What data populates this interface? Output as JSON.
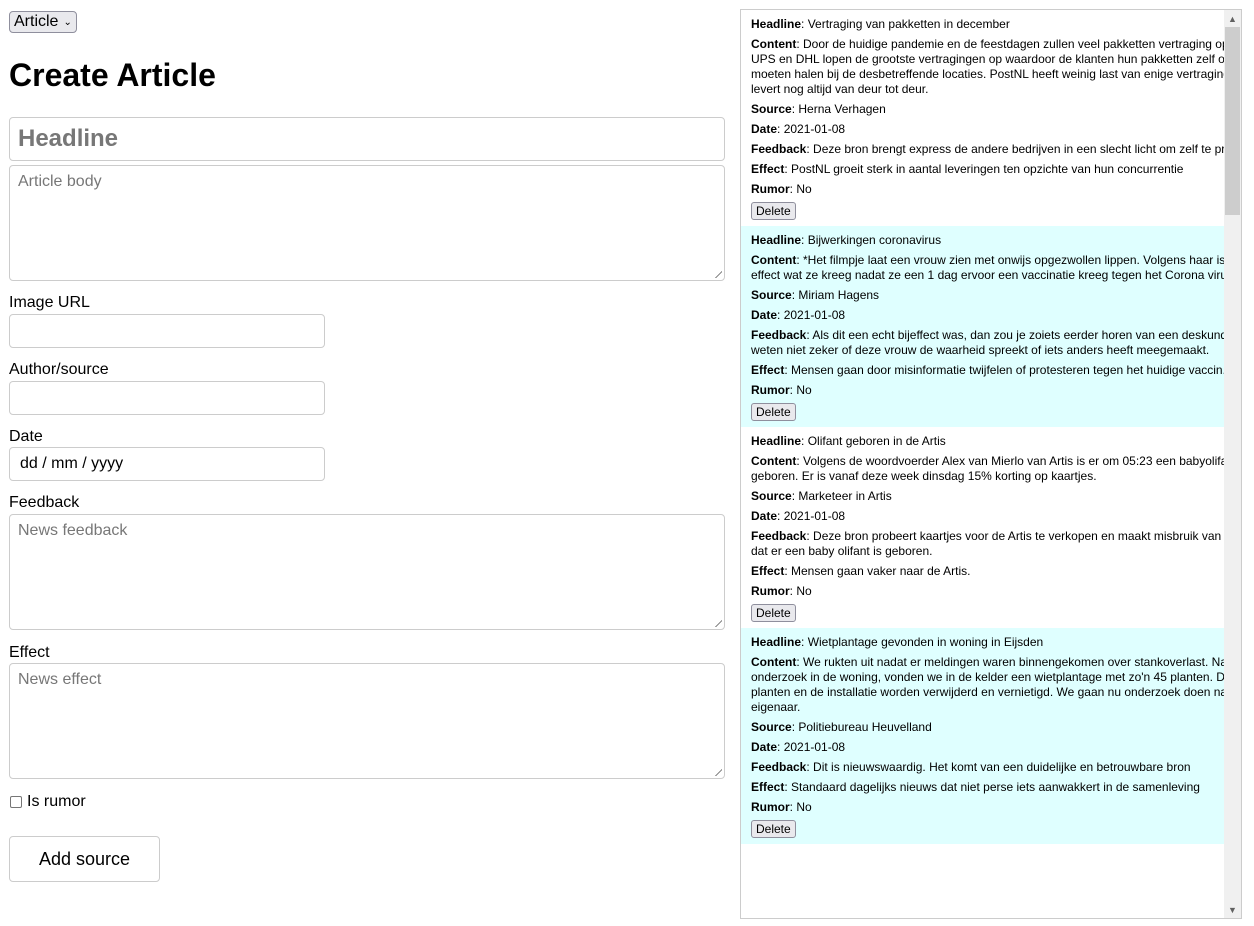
{
  "type_select": {
    "value": "Article"
  },
  "form": {
    "title": "Create Article",
    "headline_placeholder": "Headline",
    "body_placeholder": "Article body",
    "image_url_label": "Image URL",
    "author_label": "Author/source",
    "date_label": "Date",
    "date_placeholder": "dd / mm / yyyy",
    "feedback_label": "Feedback",
    "feedback_placeholder": "News feedback",
    "effect_label": "Effect",
    "effect_placeholder": "News effect",
    "rumor_label": "Is rumor",
    "rumor_checked": false,
    "submit_label": "Add source"
  },
  "field_labels": {
    "headline": "Headline",
    "content": "Content",
    "source": "Source",
    "date": "Date",
    "feedback": "Feedback",
    "effect": "Effect",
    "rumor": "Rumor",
    "delete": "Delete"
  },
  "articles": [
    {
      "headline": "Vertraging van pakketten in december",
      "content": "Door de huidige pandemie en de feestdagen zullen veel pakketten vertraging oplopen. UPS en DHL lopen de grootste vertragingen op waardoor de klanten hun pakketten zelf op moeten halen bij de desbetreffende locaties. PostNL heeft weinig last van enige vertraging en levert nog altijd van deur tot deur.",
      "source": "Herna Verhagen",
      "date": "2021-01-08",
      "feedback": "Deze bron brengt express de andere bedrijven in een slecht licht om zelf te profiteren.",
      "effect": "PostNL groeit sterk in aantal leveringen ten opzichte van hun concurrentie",
      "rumor": "No"
    },
    {
      "headline": "Bijwerkingen coronavirus",
      "content": "*Het filmpje laat een vrouw zien met onwijs opgezwollen lippen. Volgens haar is dit het effect wat ze kreeg nadat ze een 1 dag ervoor een vaccinatie kreeg tegen het Corona virus.",
      "source": "Miriam Hagens",
      "date": "2021-01-08",
      "feedback": "Als dit een echt bijeffect was, dan zou je zoiets eerder horen van een deskundige. We weten niet zeker of deze vrouw de waarheid spreekt of iets anders heeft meegemaakt.",
      "effect": "Mensen gaan door misinformatie twijfelen of protesteren tegen het huidige vaccin.",
      "rumor": "No"
    },
    {
      "headline": "Olifant geboren in de Artis",
      "content": "Volgens de woordvoerder Alex van Mierlo van Artis is er om 05:23 een babyolifant geboren. Er is vanaf deze week dinsdag 15% korting op kaartjes.",
      "source": "Marketeer in Artis",
      "date": "2021-01-08",
      "feedback": "Deze bron probeert kaartjes voor de Artis te verkopen en maakt misbruik van het feit dat er een baby olifant is geboren.",
      "effect": "Mensen gaan vaker naar de Artis.",
      "rumor": "No"
    },
    {
      "headline": "Wietplantage gevonden in woning in Eijsden",
      "content": "We rukten uit nadat er meldingen waren binnengekomen over stankoverlast. Na onderzoek in de woning, vonden we in de kelder een wietplantage met zo'n 45 planten. De planten en de installatie worden verwijderd en vernietigd. We gaan nu onderzoek doen naar de eigenaar.",
      "source": "Politiebureau Heuvelland",
      "date": "2021-01-08",
      "feedback": "Dit is nieuwswaardig. Het komt van een duidelijke en betrouwbare bron",
      "effect": "Standaard dagelijks nieuws dat niet perse iets aanwakkert in de samenleving",
      "rumor": "No"
    }
  ],
  "colors": {
    "alt_card_bg": "#dfffff",
    "placeholder": "#777777",
    "border": "#cccccc"
  }
}
